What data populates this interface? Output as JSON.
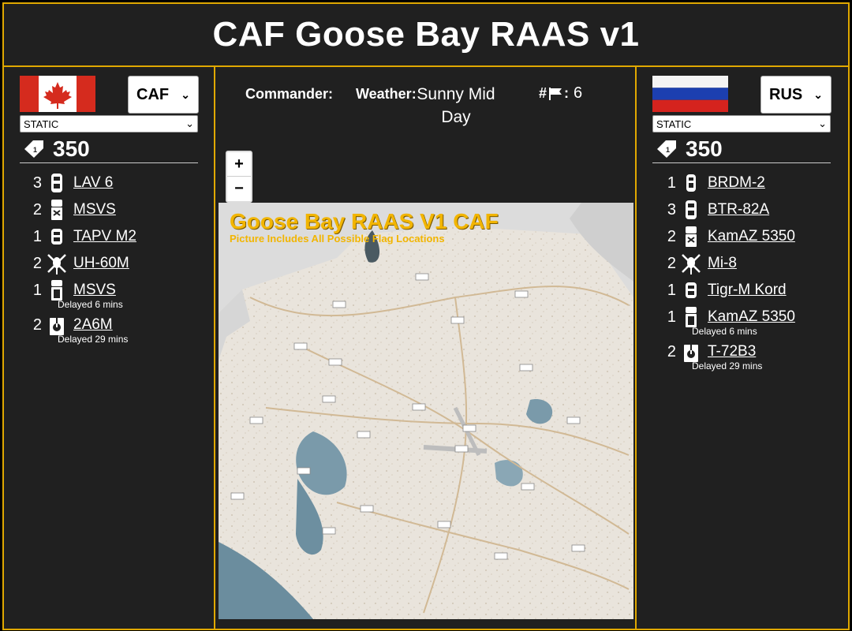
{
  "title": "CAF Goose Bay RAAS v1",
  "left": {
    "faction": "CAF",
    "mode": "STATIC",
    "tickets": "350",
    "vehicles": [
      {
        "count": "3",
        "name": "LAV 6",
        "icon": "wheeled-apc-icon"
      },
      {
        "count": "2",
        "name": "MSVS",
        "icon": "logistics-truck-icon"
      },
      {
        "count": "1",
        "name": "TAPV M2",
        "icon": "mrap-icon"
      },
      {
        "count": "2",
        "name": "UH-60M",
        "icon": "helicopter-icon"
      },
      {
        "count": "1",
        "name": "MSVS",
        "icon": "transport-truck-icon",
        "delay": "Delayed 6 mins"
      },
      {
        "count": "2",
        "name": "2A6M",
        "icon": "tank-icon",
        "delay": "Delayed 29 mins"
      }
    ]
  },
  "right": {
    "faction": "RUS",
    "mode": "STATIC",
    "tickets": "350",
    "vehicles": [
      {
        "count": "1",
        "name": "BRDM-2",
        "icon": "scout-car-icon"
      },
      {
        "count": "3",
        "name": "BTR-82A",
        "icon": "wheeled-apc-icon"
      },
      {
        "count": "2",
        "name": "KamAZ 5350",
        "icon": "logistics-truck-icon"
      },
      {
        "count": "2",
        "name": "Mi-8",
        "icon": "helicopter-icon"
      },
      {
        "count": "1",
        "name": "Tigr-M Kord",
        "icon": "mrap-icon"
      },
      {
        "count": "1",
        "name": "KamAZ 5350",
        "icon": "transport-truck-icon",
        "delay": "Delayed 6 mins"
      },
      {
        "count": "2",
        "name": "T-72B3",
        "icon": "tank-icon",
        "delay": "Delayed 29 mins"
      }
    ]
  },
  "middle": {
    "commander_label": "Commander:",
    "commander_value": "",
    "weather_label": "Weather:",
    "weather_value": "Sunny Mid Day",
    "flags_label_prefix": "#",
    "flags_label_suffix": ":",
    "flags_value": "6",
    "zoom_in": "+",
    "zoom_out": "−",
    "map_title": "Goose Bay RAAS V1 CAF",
    "map_subtitle": "Picture Includes All Possible Flag Locations"
  },
  "colors": {
    "accent": "#e0a800",
    "map_title": "#f2b500"
  }
}
